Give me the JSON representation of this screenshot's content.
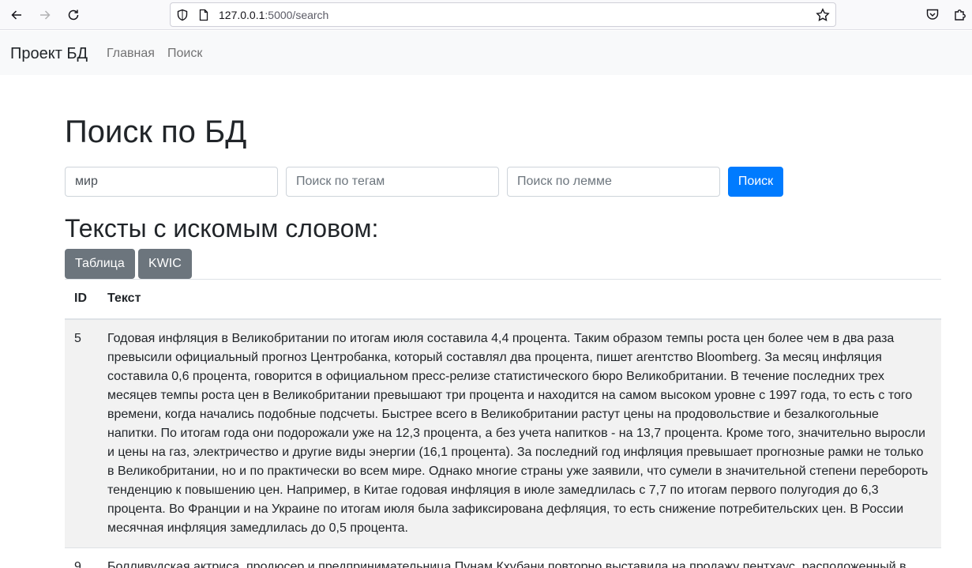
{
  "browser": {
    "url_host": "127.0.0.1",
    "url_path": ":5000/search"
  },
  "navbar": {
    "brand": "Проект БД",
    "links": [
      "Главная",
      "Поиск"
    ]
  },
  "main": {
    "title": "Поиск по БД",
    "word_input": {
      "value": "мир",
      "placeholder": ""
    },
    "tags_input": {
      "value": "",
      "placeholder": "Поиск по тегам"
    },
    "lemma_input": {
      "value": "",
      "placeholder": "Поиск по лемме"
    },
    "search_button": "Поиск",
    "results_title": "Тексты с искомым словом:",
    "view_buttons": [
      "Таблица",
      "KWIC"
    ]
  },
  "table": {
    "headers": [
      "ID",
      "Текст"
    ],
    "rows": [
      {
        "id": "5",
        "text": "Годовая инфляция в Великобритании по итогам июля составила 4,4 процента. Таким образом темпы роста цен более чем в два раза превысили официальный прогноз Центробанка, который составлял два процента, пишет агентство Bloomberg. За месяц инфляция составила 0,6 процента, говорится в официальном пресс-релизе статистического бюро Великобритании. В течение последних трех месяцев темпы роста цен в Великобритании превышают три процента и находится на самом высоком уровне с 1997 года, то есть с того времени, когда начались подобные подсчеты. Быстрее всего в Великобритании растут цены на продовольствие и безалкогольные напитки. По итогам года они подорожали уже на 12,3 процента, а без учета напитков - на 13,7 процента. Кроме того, значительно выросли и цены на газ, электричество и другие виды энергии (16,1 процента). За последний год инфляция превышает прогнозные рамки не только в Великобритании, но и по практически во всем мире. Однако многие страны уже заявили, что сумели в значительной степени перебороть тенденцию к повышению цен. Например, в Китае годовая инфляция в июле замедлилась с 7,7 по итогам первого полугодия до 6,3 процента. Во Франции и на Украине по итогам июля была зафиксирована дефляция, то есть снижение потребительских цен. В России месячная инфляция замедлилась до 0,5 процента."
      },
      {
        "id": "9",
        "text": "Болливудская актриса, продюсер и предпринимательница Пунам Кхубани повторно выставила на продажу пентхаус, расположенный в"
      }
    ]
  }
}
